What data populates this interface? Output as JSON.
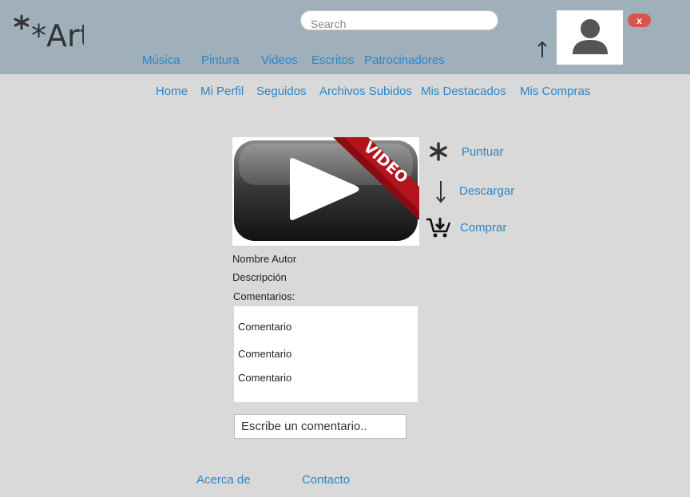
{
  "header": {
    "logo_text": "*Art",
    "search": {
      "placeholder": "Search",
      "value": ""
    },
    "nav": [
      "Música",
      "Pintura",
      "Videos",
      "Escritos",
      "Patrocinadores"
    ],
    "close_label": "x",
    "icons": {
      "up": "arrow-up-icon",
      "avatar": "user-avatar-icon"
    }
  },
  "sub_nav": [
    "Home",
    "Mi Perfil",
    "Seguidos",
    "Archivos Subidos",
    "Mis Destacados",
    "Mis Compras"
  ],
  "media": {
    "thumbnail_badge": "VIDEO",
    "thumbnail_icon": "video-play-icon",
    "author": "Nombre Autor",
    "description": "Descripción",
    "comments_label": "Comentarios:",
    "comments": [
      "Comentario",
      "Comentario",
      "Comentario"
    ],
    "comment_input_placeholder": "Escribe un comentario.."
  },
  "actions": [
    {
      "label": "Puntuar",
      "icon": "asterisk-icon"
    },
    {
      "label": "Descargar",
      "icon": "download-arrow-icon"
    },
    {
      "label": "Comprar",
      "icon": "cart-add-icon"
    }
  ],
  "footer": [
    "Acerca de",
    "Contacto"
  ],
  "colors": {
    "header_bg": "#9fb0bb",
    "page_bg": "#d9d9d9",
    "link": "#2a86c8",
    "close_btn": "#d9534f"
  }
}
